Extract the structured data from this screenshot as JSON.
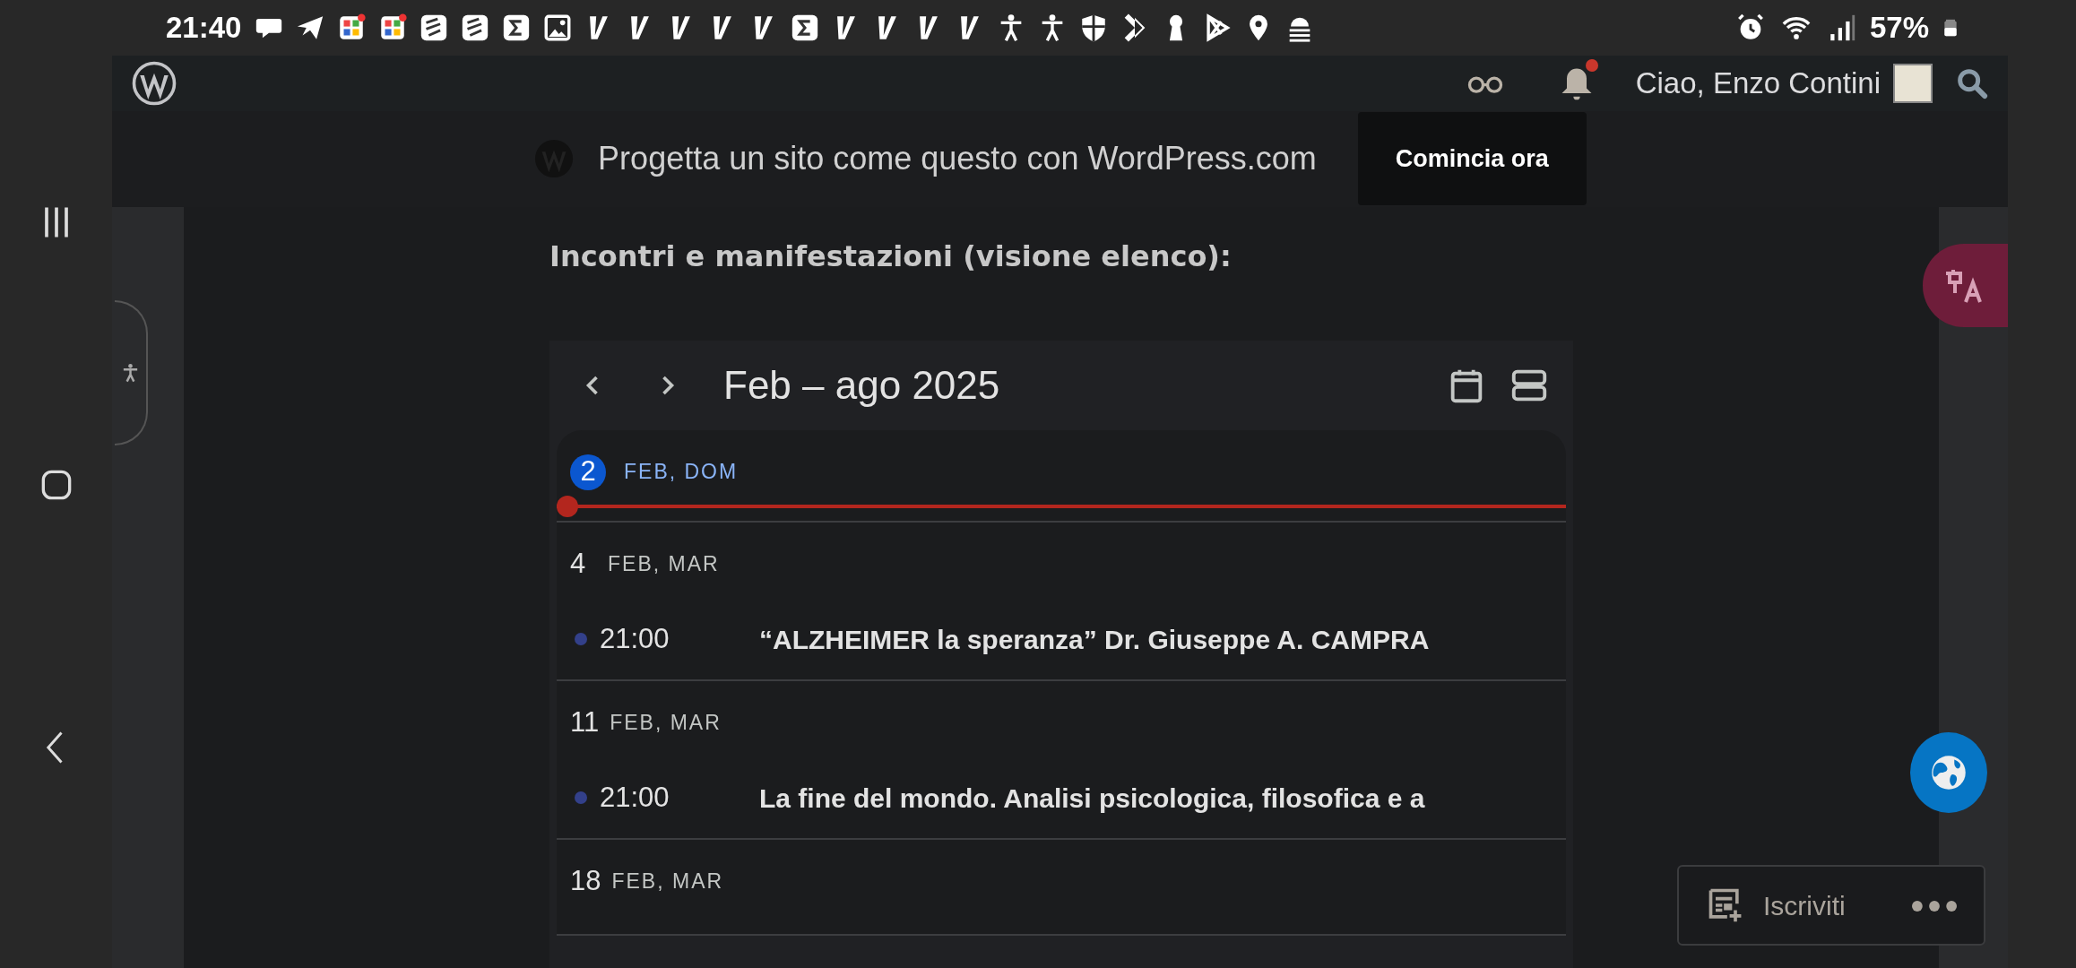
{
  "status_bar": {
    "time": "21:40",
    "battery": "57%"
  },
  "admin_bar": {
    "greeting": "Ciao, Enzo Contini",
    "notifications_unread": true
  },
  "banner": {
    "text": "Progetta un sito come questo con WordPress.com",
    "button": "Comincia ora"
  },
  "heading": "Incontri e manifestazioni (visione elenco):",
  "calendar": {
    "range": "Feb – ago 2025",
    "days": [
      {
        "day": "2",
        "date": "FEB, DOM",
        "today": true
      },
      {
        "day": "4",
        "date": "FEB, MAR",
        "today": false,
        "events": [
          {
            "time": "21:00",
            "title": "“ALZHEIMER la speranza” Dr. Giuseppe A. CAMPRA"
          }
        ]
      },
      {
        "day": "11",
        "date": "FEB, MAR",
        "today": false,
        "events": [
          {
            "time": "21:00",
            "title": "La fine del mondo. Analisi psicologica, filosofica e a"
          }
        ]
      },
      {
        "day": "18",
        "date": "FEB, MAR",
        "today": false
      }
    ]
  },
  "subscribe": {
    "label": "Iscriviti"
  }
}
